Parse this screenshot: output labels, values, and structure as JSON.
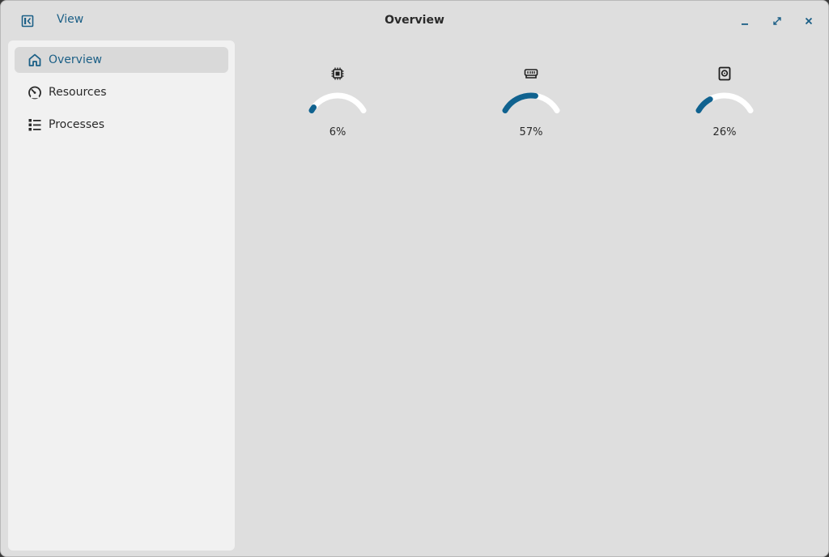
{
  "titlebar": {
    "title": "Overview",
    "view_menu_label": "View",
    "sidebar_toggle_icon": "sidebar-toggle-icon",
    "minimize_icon": "minimize-icon",
    "maximize_icon": "maximize-icon",
    "close_icon": "close-icon"
  },
  "sidebar": {
    "items": [
      {
        "label": "Overview",
        "icon": "home-icon",
        "active": true
      },
      {
        "label": "Resources",
        "icon": "speedometer-icon",
        "active": false
      },
      {
        "label": "Processes",
        "icon": "list-icon",
        "active": false
      }
    ]
  },
  "gauges": [
    {
      "icon": "cpu-icon",
      "value": 6,
      "value_label": "6%"
    },
    {
      "icon": "memory-icon",
      "value": 57,
      "value_label": "57%"
    },
    {
      "icon": "disk-icon",
      "value": 26,
      "value_label": "26%"
    }
  ],
  "colors": {
    "accent": "#10628f",
    "track": "#ffffff",
    "window_bg": "#dedede",
    "sidebar_bg": "#f1f1f1",
    "sidebar_active": "#d9d9d9"
  }
}
